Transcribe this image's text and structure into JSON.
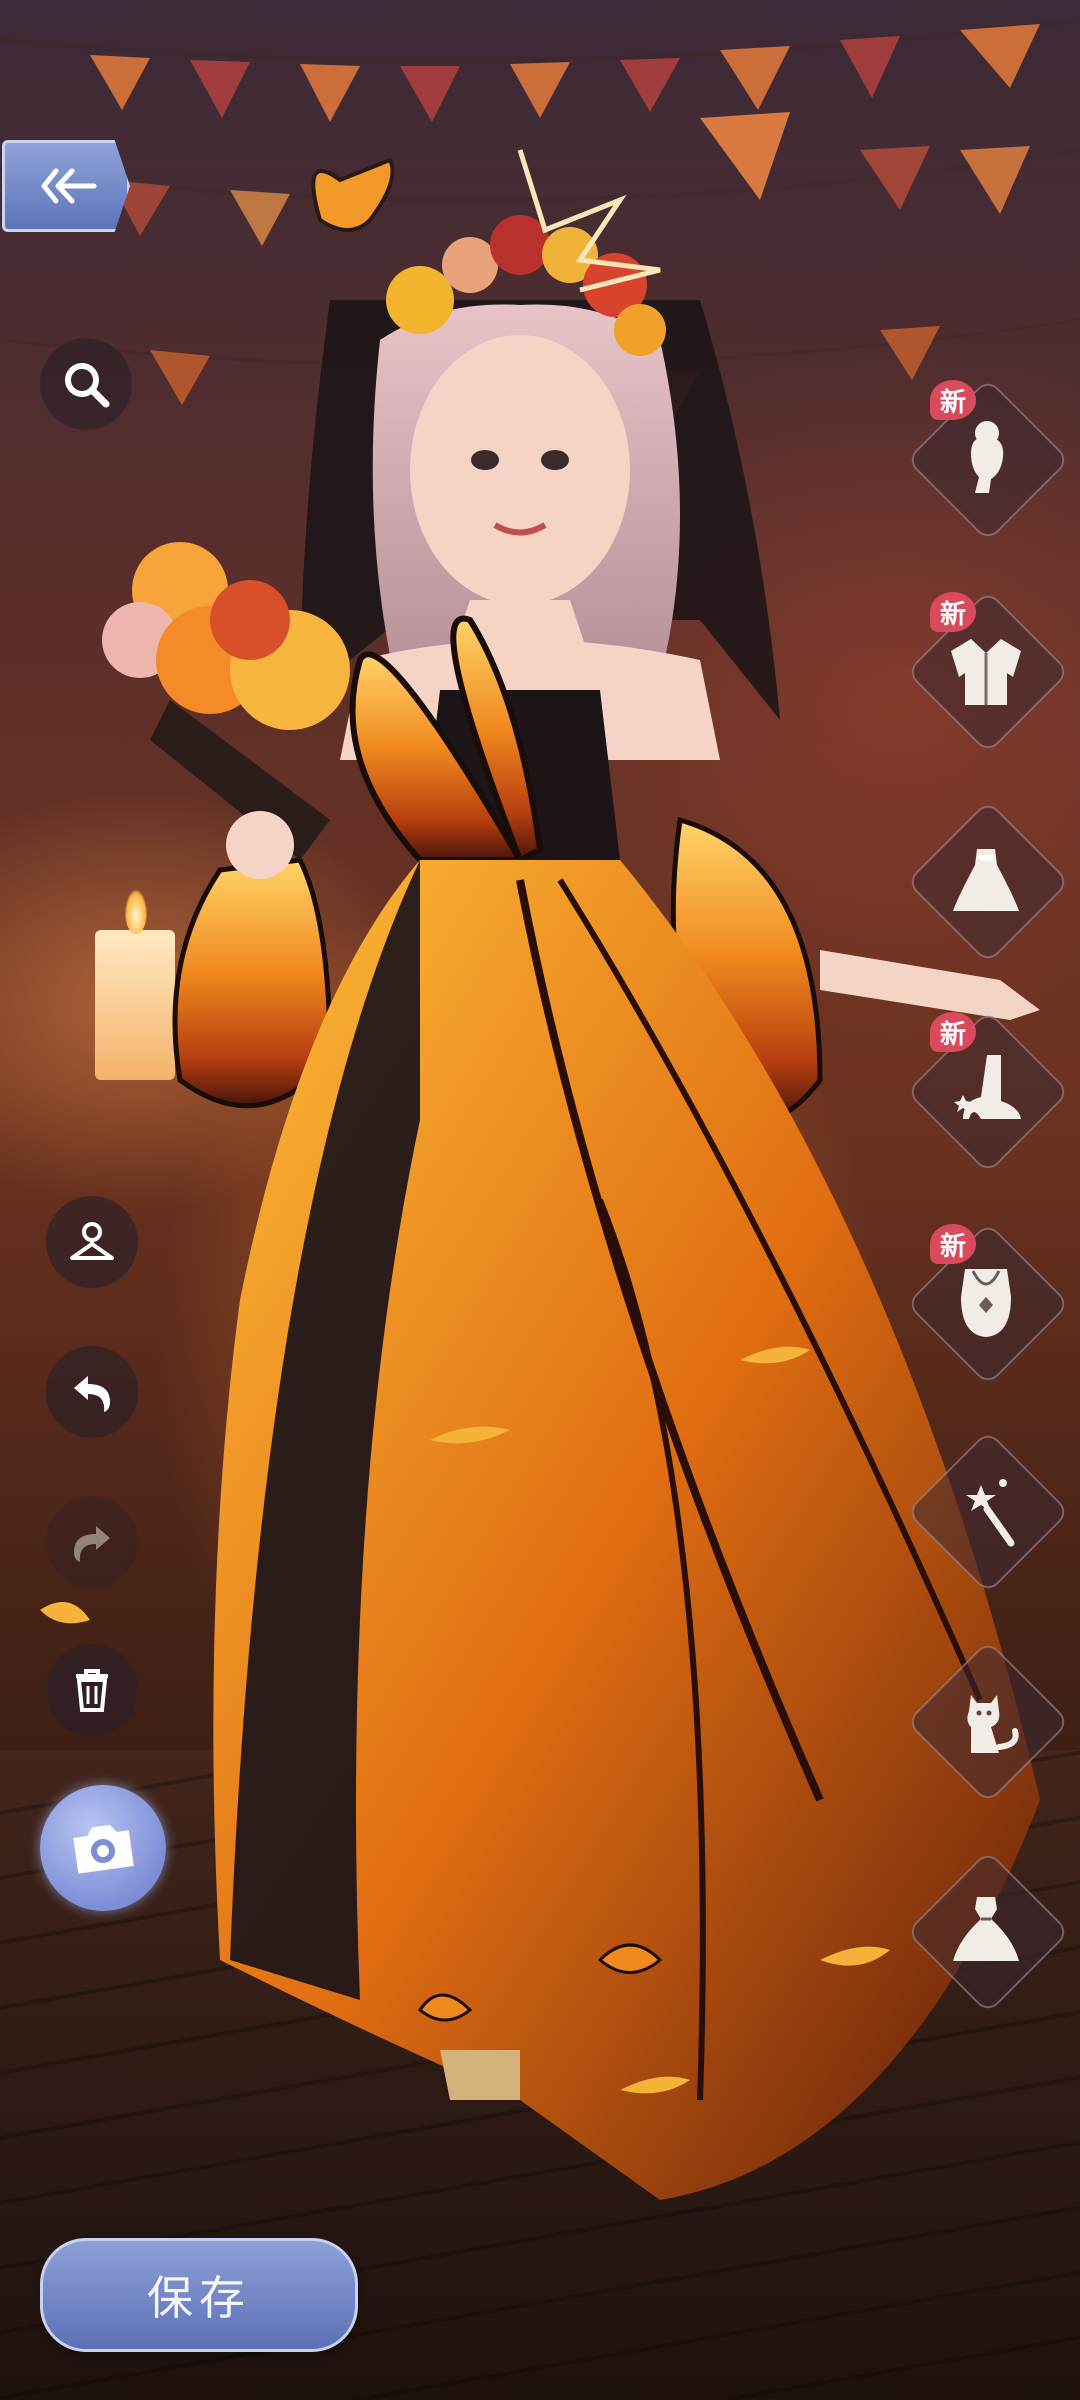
{
  "toolbar": {
    "save_label": "保存",
    "new_badge": "新"
  },
  "left_tools": [
    "back",
    "search",
    "hanger",
    "undo",
    "redo",
    "delete",
    "camera"
  ],
  "categories": [
    {
      "name": "hairstyle",
      "new": true
    },
    {
      "name": "jacket",
      "new": true
    },
    {
      "name": "dress",
      "new": false
    },
    {
      "name": "shoes",
      "new": true
    },
    {
      "name": "necklace",
      "new": true
    },
    {
      "name": "handheld-wand",
      "new": false
    },
    {
      "name": "pet-cat",
      "new": false
    },
    {
      "name": "outfit-dress",
      "new": false
    }
  ],
  "colors": {
    "accent": "#7d8ed6",
    "badge": "#d94a5d"
  }
}
